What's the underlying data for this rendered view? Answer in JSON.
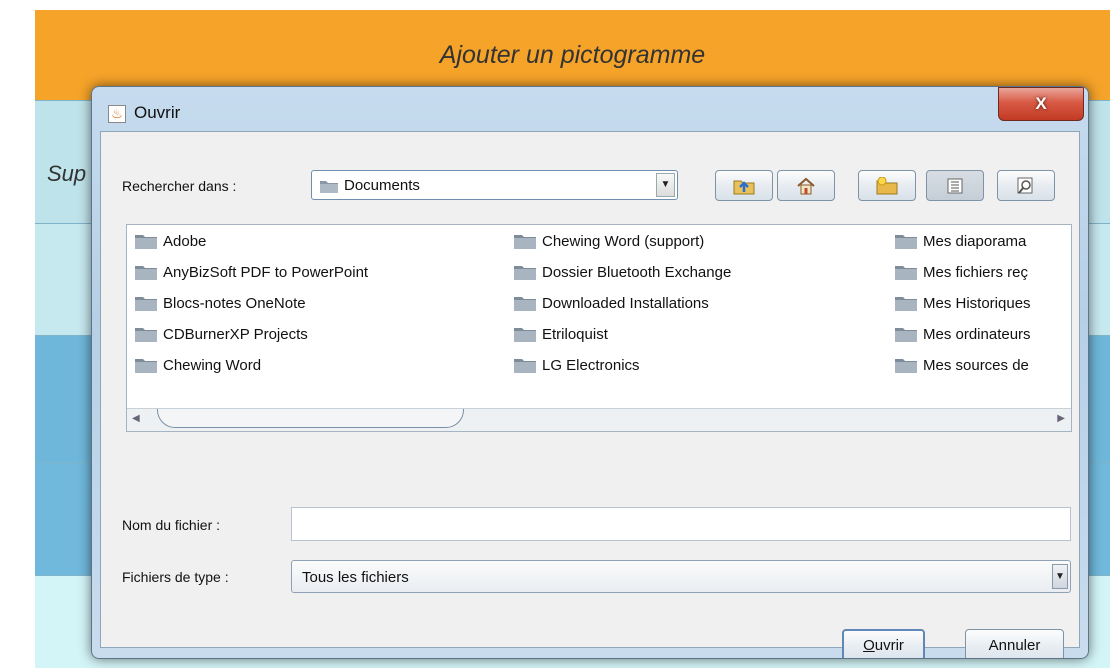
{
  "background": {
    "header_title": "Ajouter un pictogramme",
    "row_label": "Sup"
  },
  "dialog": {
    "title": "Ouvrir",
    "close_label": "X",
    "look_in_label": "Rechercher dans :",
    "look_in_value": "Documents",
    "toolbar": {
      "up": "up-folder-icon",
      "home": "home-icon",
      "new_folder": "new-folder-icon",
      "list": "list-view-icon",
      "details": "details-view-icon"
    },
    "files": [
      {
        "name": "Adobe"
      },
      {
        "name": "AnyBizSoft PDF to PowerPoint"
      },
      {
        "name": "Blocs-notes OneNote"
      },
      {
        "name": "CDBurnerXP Projects"
      },
      {
        "name": "Chewing Word"
      },
      {
        "name": "Chewing Word (support)"
      },
      {
        "name": "Dossier Bluetooth Exchange"
      },
      {
        "name": "Downloaded Installations"
      },
      {
        "name": "Etriloquist"
      },
      {
        "name": "LG Electronics"
      },
      {
        "name": "Mes diaporama"
      },
      {
        "name": "Mes fichiers reç"
      },
      {
        "name": "Mes Historiques"
      },
      {
        "name": "Mes ordinateurs"
      },
      {
        "name": "Mes sources de"
      }
    ],
    "filename_label": "Nom du fichier :",
    "filename_value": "",
    "filetype_label": "Fichiers de type :",
    "filetype_value": "Tous les fichiers",
    "open_button": {
      "mnemonic": "O",
      "rest": "uvrir"
    },
    "cancel_button": "Annuler"
  }
}
